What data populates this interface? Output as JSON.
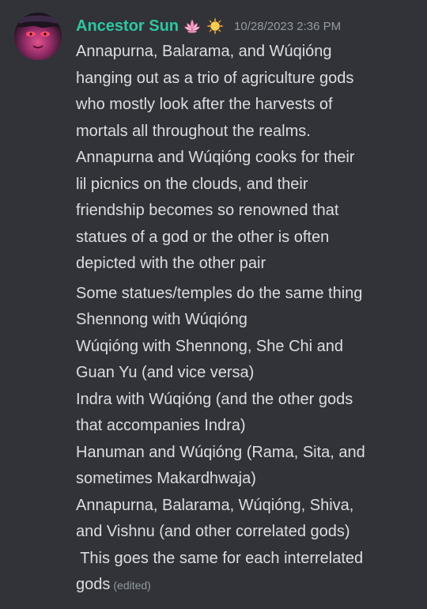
{
  "message": {
    "author": {
      "username": "Ancestor Sun",
      "emoji": [
        "lotus-emoji",
        "sun-emoji"
      ],
      "name_color": "#2dc7a1"
    },
    "timestamp": "10/28/2023 2:36 PM",
    "paragraph1": [
      "Annapurna, Balarama, and Wúqióng",
      "hanging out as a trio of agriculture gods",
      "who mostly look after the harvests of",
      "mortals all throughout the realms.",
      "Annapurna and Wúqióng cooks for their",
      "lil picnics on the clouds, and their",
      "friendship becomes so renowned that",
      "statues of a god or the other is often",
      "depicted with the other pair"
    ],
    "paragraph2": [
      "Some statues/temples do the same thing",
      "Shennong with Wúqióng",
      "Wúqióng with Shennong, She Chi and",
      "Guan Yu (and vice versa)",
      "Indra with Wúqióng (and the other gods",
      "that accompanies Indra)",
      "Hanuman and Wúqióng (Rama, Sita, and",
      "sometimes Makardhwaja)",
      "Annapurna, Balarama, Wúqióng, Shiva,",
      "and Vishnu (and other correlated gods)",
      " This goes the same for each interrelated",
      "gods"
    ],
    "edited_label": "(edited)"
  },
  "colors": {
    "background": "#313338",
    "text": "#dbdee1",
    "muted": "#949ba4"
  }
}
